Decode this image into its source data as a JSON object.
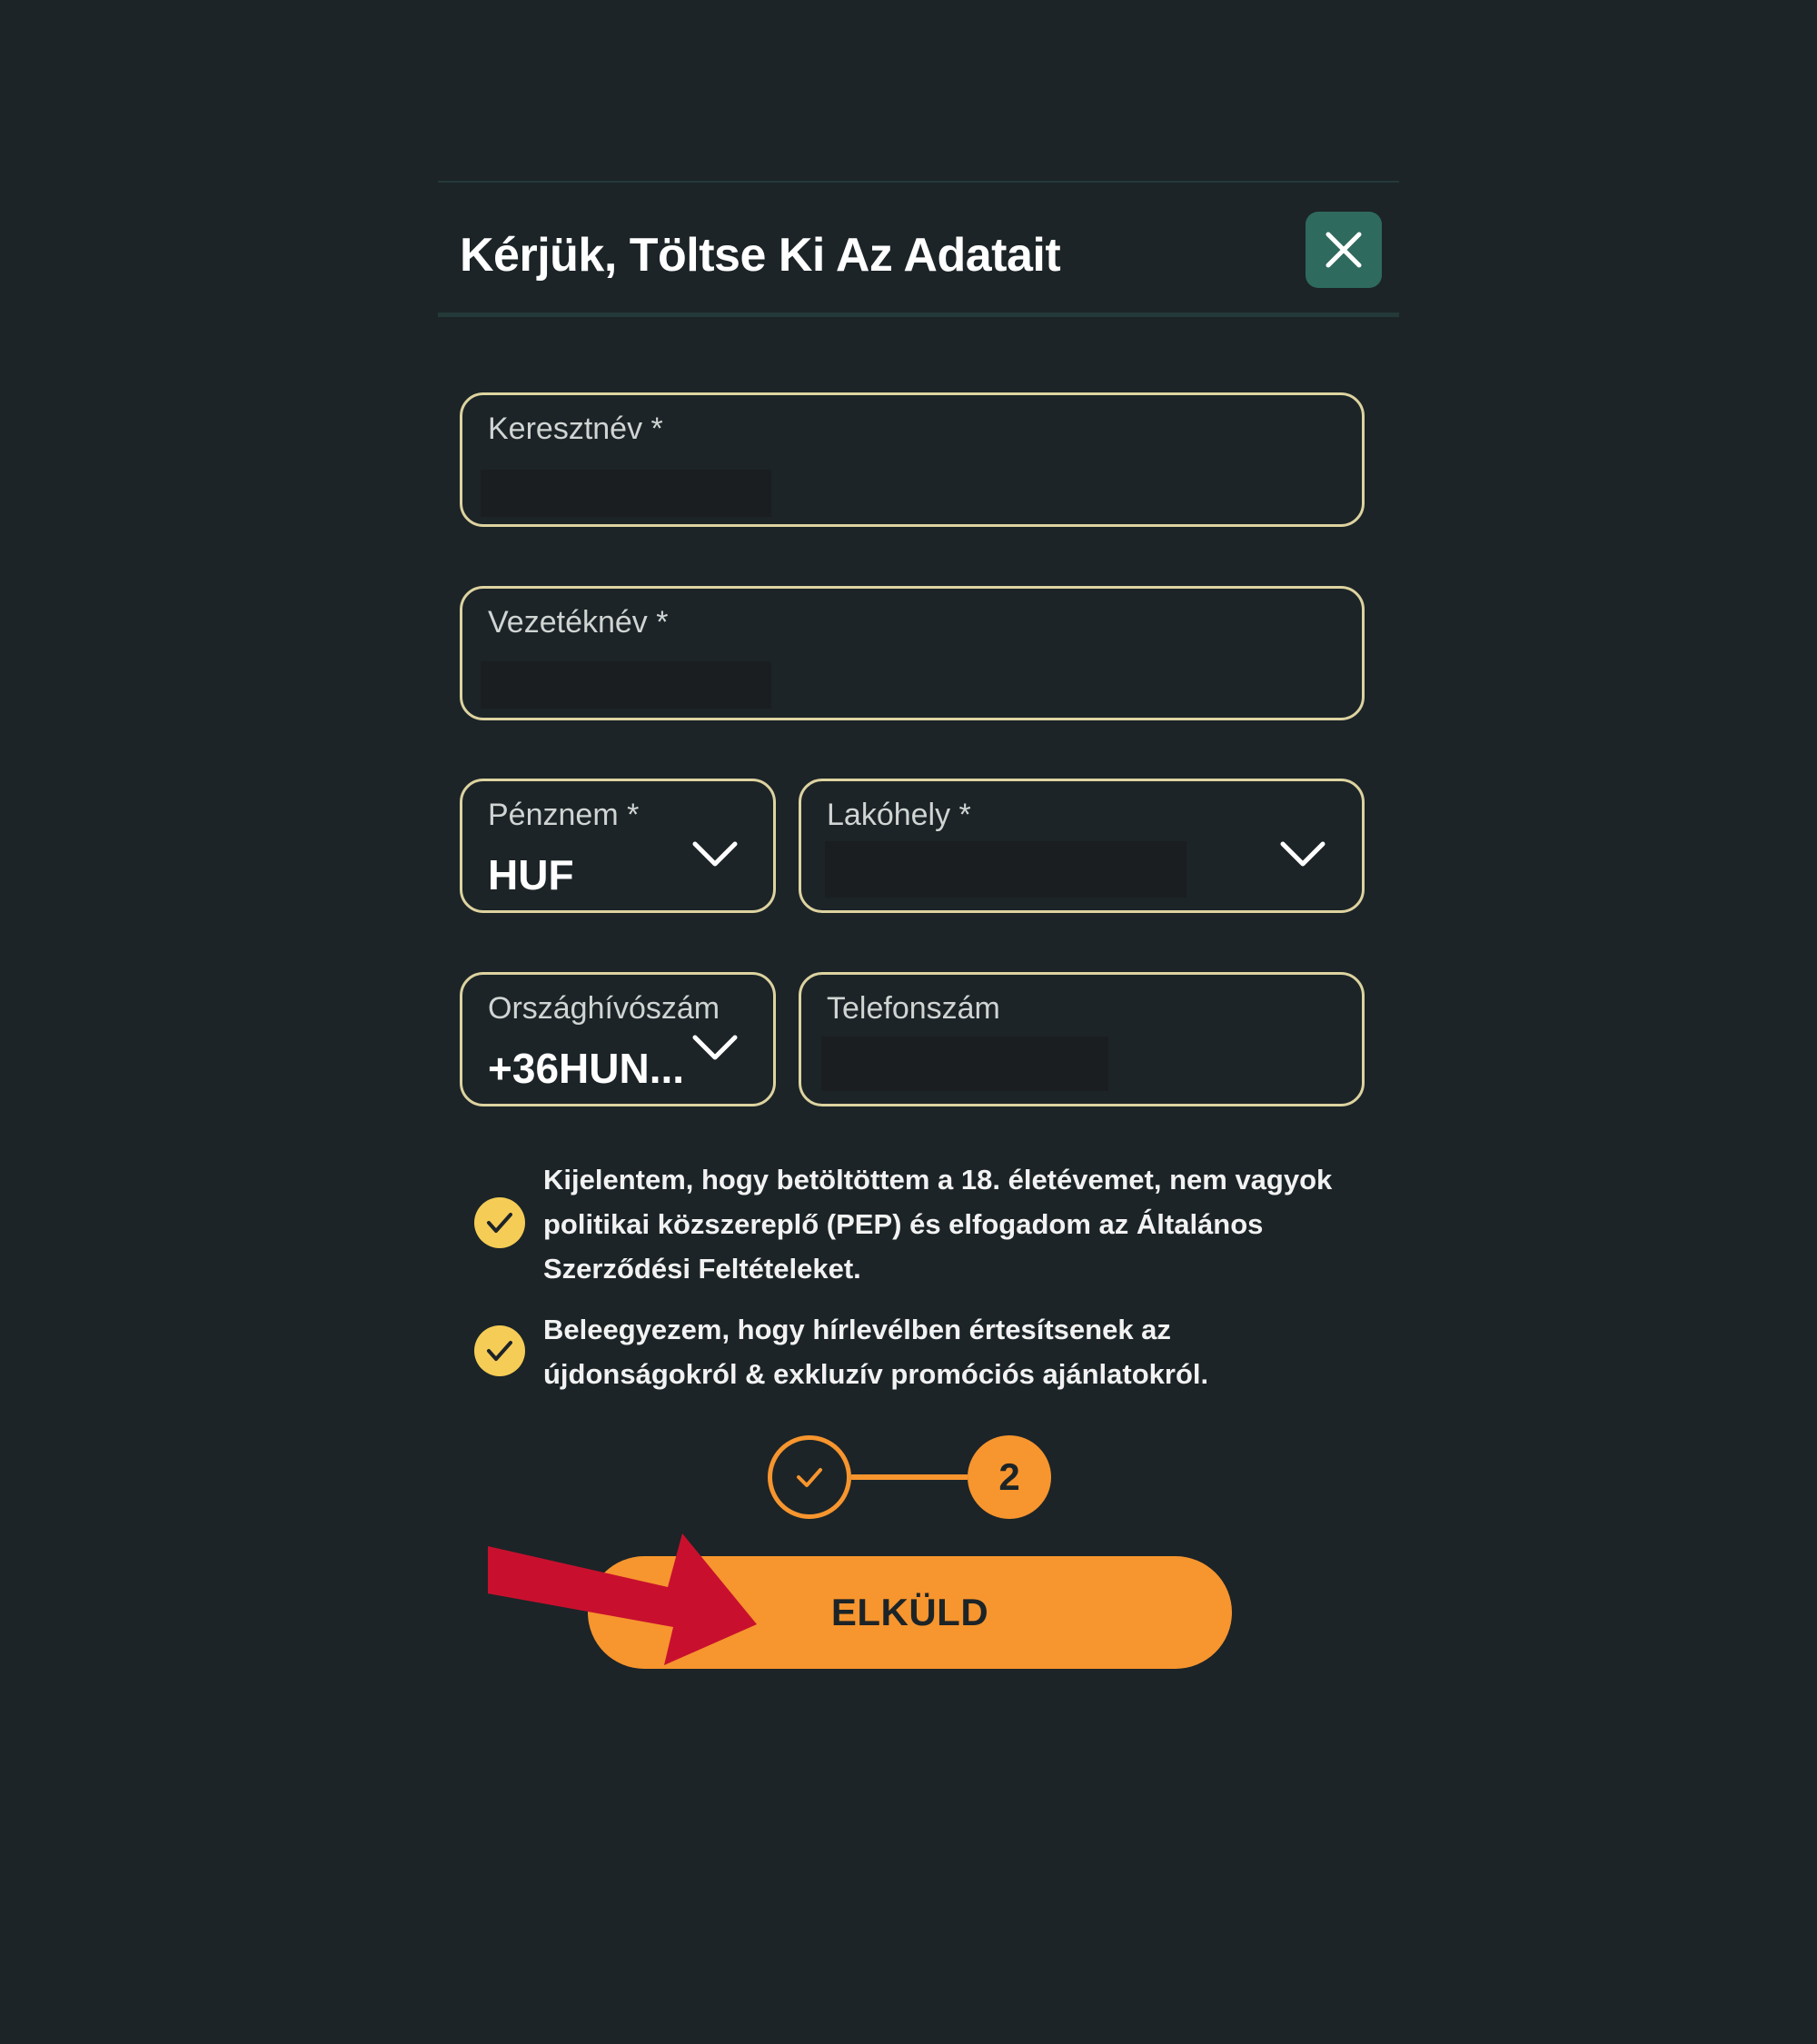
{
  "modal": {
    "title": "Kérjük, Töltse Ki Az Adatait",
    "close_icon": "close-icon"
  },
  "form": {
    "first_name": {
      "label": "Keresztnév *",
      "value": ""
    },
    "last_name": {
      "label": "Vezetéknév *",
      "value": ""
    },
    "currency": {
      "label": "Pénznem *",
      "value": "HUF"
    },
    "residence": {
      "label": "Lakóhely *",
      "value": ""
    },
    "country_code": {
      "label": "Országhívószám",
      "value": "+36HUN..."
    },
    "phone": {
      "label": "Telefonszám",
      "value": ""
    }
  },
  "consents": [
    {
      "checked": true,
      "text": "Kijelentem, hogy betöltöttem a 18. életévemet, nem vagyok politikai közszereplő (PEP) és elfogadom az Általános Szerződési Feltételeket."
    },
    {
      "checked": true,
      "text": "Beleegyezem, hogy hírlevélben értesítsenek az újdonságokról & exkluzív promóciós ajánlatokról."
    }
  ],
  "stepper": {
    "step1_icon": "check-icon",
    "step2_label": "2"
  },
  "submit": {
    "label": "ELKÜLD"
  },
  "colors": {
    "background": "#1c2427",
    "accent": "#f7952e",
    "field_border": "#ddd3a0",
    "checkbox": "#f5cc56",
    "close_button": "#2f6a5e",
    "annotation_arrow": "#c8102e"
  }
}
